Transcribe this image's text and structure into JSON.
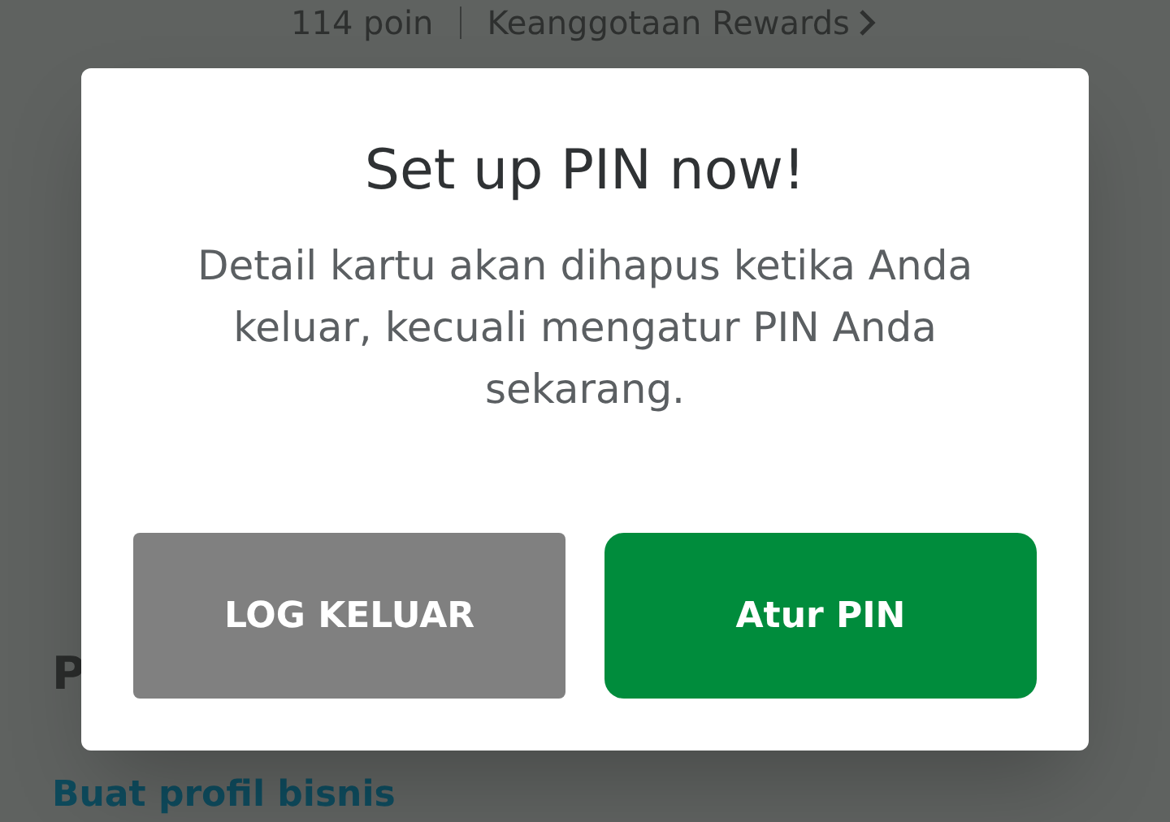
{
  "background": {
    "points": "114 poin",
    "membership_link": "Keanggotaan Rewards",
    "section_heading": "P",
    "business_link": "Buat profil bisnis"
  },
  "dialog": {
    "title": "Set up PIN now!",
    "message": "Detail kartu akan dihapus ketika Anda keluar, kecuali mengatur PIN Anda sekarang.",
    "buttons": [
      {
        "label": "LOG KELUAR",
        "kind": "secondary"
      },
      {
        "label": "Atur PIN",
        "kind": "primary"
      }
    ]
  }
}
